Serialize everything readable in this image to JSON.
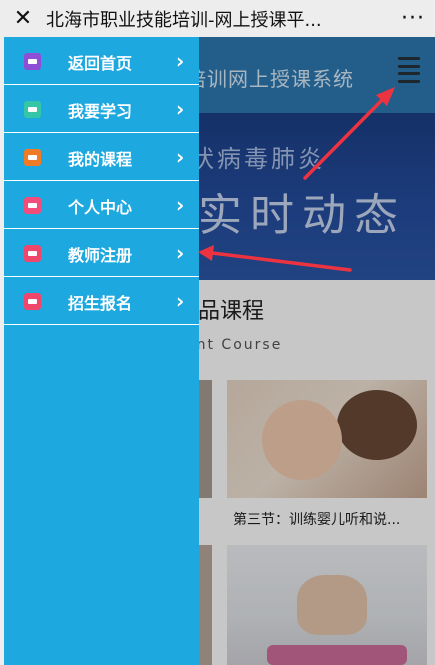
{
  "topbar": {
    "close_glyph": "✕",
    "title": "北海市职业技能培训-网上授课平...",
    "more_glyph": "···"
  },
  "background_page": {
    "header_title": "培训网上授课系统",
    "banner_line1": "状病毒肺炎",
    "banner_line2": "实时动态",
    "section_title": "品课程",
    "section_subtitle": "ent Course",
    "caption_left": "。",
    "caption_course2": "第三节：训练婴儿听和说..."
  },
  "drawer": {
    "items": [
      {
        "label": "返回首页",
        "icon": "home-icon",
        "color": "#8e4fd6",
        "chev": "›"
      },
      {
        "label": "我要学习",
        "icon": "study-icon",
        "color": "#35c6a7",
        "chev": "›"
      },
      {
        "label": "我的课程",
        "icon": "course-icon",
        "color": "#f07b27",
        "chev": "›"
      },
      {
        "label": "个人中心",
        "icon": "profile-icon",
        "color": "#f14c7a",
        "chev": "›"
      },
      {
        "label": "教师注册",
        "icon": "teacher-register-icon",
        "color": "#f0466b",
        "chev": "›"
      },
      {
        "label": "招生报名",
        "icon": "enrollment-icon",
        "color": "#f0466b",
        "chev": "›"
      }
    ]
  },
  "colors": {
    "drawer_bg": "#1da8e0",
    "header_bg": "#2d79b3",
    "annotation_red": "#ee3340"
  }
}
